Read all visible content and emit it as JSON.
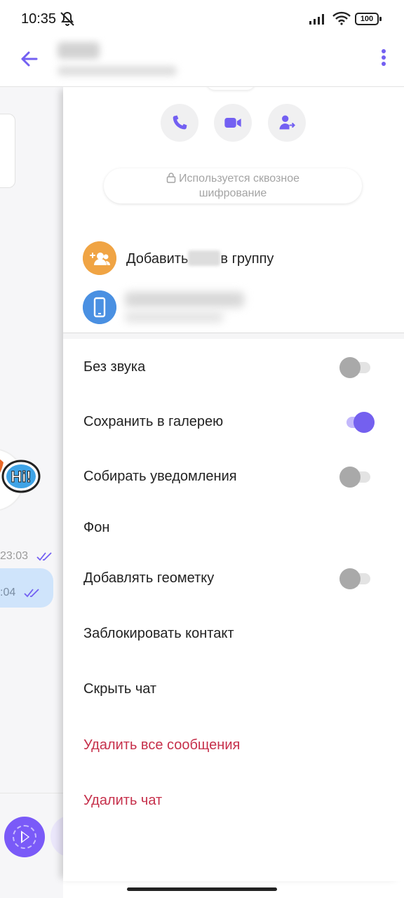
{
  "status_bar": {
    "time": "10:35",
    "battery": "100"
  },
  "header": {
    "back_icon": "arrow-left-icon",
    "more_icon": "more-vertical-icon"
  },
  "chat_background": {
    "message_time_1": "23:03",
    "message_time_2": ":04",
    "sticker_text": "Hi!"
  },
  "panel": {
    "actions": [
      {
        "icon": "phone-icon"
      },
      {
        "icon": "video-icon"
      },
      {
        "icon": "share-contact-icon"
      }
    ],
    "encryption_line1": "Используется сквозное",
    "encryption_line2": "шифрование",
    "add_group_prefix": "Добавить",
    "add_group_suffix": "в группу",
    "settings": {
      "mute_label": "Без звука",
      "mute_on": false,
      "save_gallery_label": "Сохранить в галерею",
      "save_gallery_on": true,
      "collect_notifications_label": "Собирать уведомления",
      "collect_notifications_on": false,
      "background_label": "Фон",
      "geotag_label": "Добавлять геометку",
      "geotag_on": false,
      "block_label": "Заблокировать контакт",
      "hide_label": "Скрыть чат",
      "delete_messages_label": "Удалить все сообщения",
      "delete_chat_label": "Удалить чат"
    }
  },
  "colors": {
    "accent": "#7360f2",
    "danger": "#c6304b",
    "group_avatar": "#f0a444",
    "phone_avatar": "#4a90e2"
  }
}
